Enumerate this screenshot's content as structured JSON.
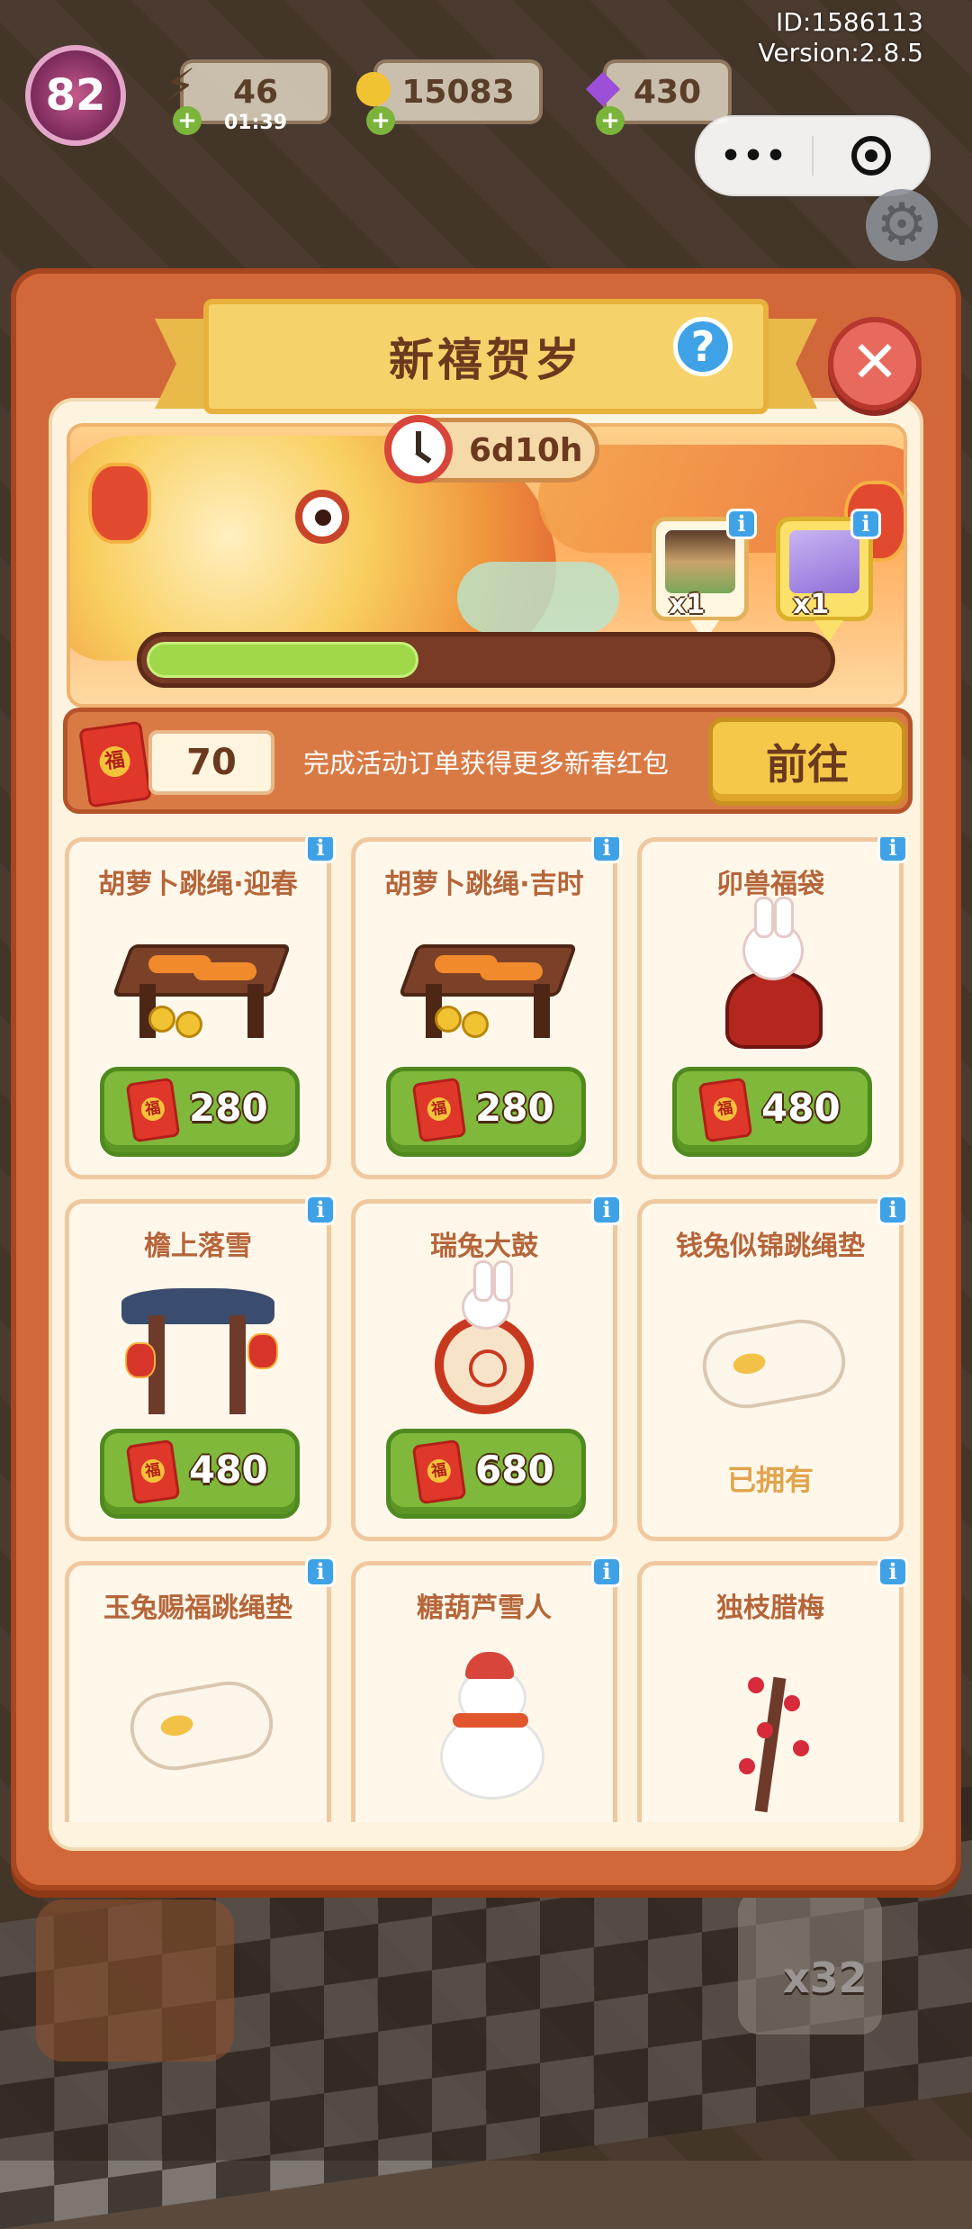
{
  "hud": {
    "level": "82",
    "energy": "46",
    "energy_timer": "01:39",
    "coins": "15083",
    "gems": "430",
    "id_text": "ID:1586113",
    "version_text": "Version:2.8.5",
    "bottom_counter": "x32"
  },
  "dialog": {
    "title": "新禧贺岁",
    "timer": "6d10h",
    "progress_fraction": 0.4,
    "rewards": [
      {
        "qty": "x1",
        "icon": "shop-building-reward"
      },
      {
        "qty": "x1",
        "icon": "upgrade-card-reward"
      }
    ],
    "currency": {
      "amount": "70",
      "description": "完成活动订单获得更多新春红包",
      "goto_label": "前往"
    }
  },
  "shop": {
    "items": [
      {
        "name": "胡萝卜跳绳·迎春",
        "price": "280",
        "owned": false,
        "art": "bench"
      },
      {
        "name": "胡萝卜跳绳·吉时",
        "price": "280",
        "owned": false,
        "art": "bench"
      },
      {
        "name": "卯兽福袋",
        "price": "480",
        "owned": false,
        "art": "pot"
      },
      {
        "name": "檐上落雪",
        "price": "480",
        "owned": false,
        "art": "gate"
      },
      {
        "name": "瑞兔大鼓",
        "price": "680",
        "owned": false,
        "art": "drum"
      },
      {
        "name": "钱兔似锦跳绳垫",
        "owned_label": "已拥有",
        "owned": true,
        "art": "mat"
      },
      {
        "name": "玉兔赐福跳绳垫",
        "art": "mat"
      },
      {
        "name": "糖葫芦雪人",
        "art": "snowman"
      },
      {
        "name": "独枝腊梅",
        "art": "plum-tree"
      }
    ]
  },
  "colors": {
    "panel": "#d2683a",
    "accent_green": "#7fb83a",
    "title_gold": "#f6d36a",
    "progress_green": "#9fd94a",
    "info_blue": "#3fa2e6"
  }
}
